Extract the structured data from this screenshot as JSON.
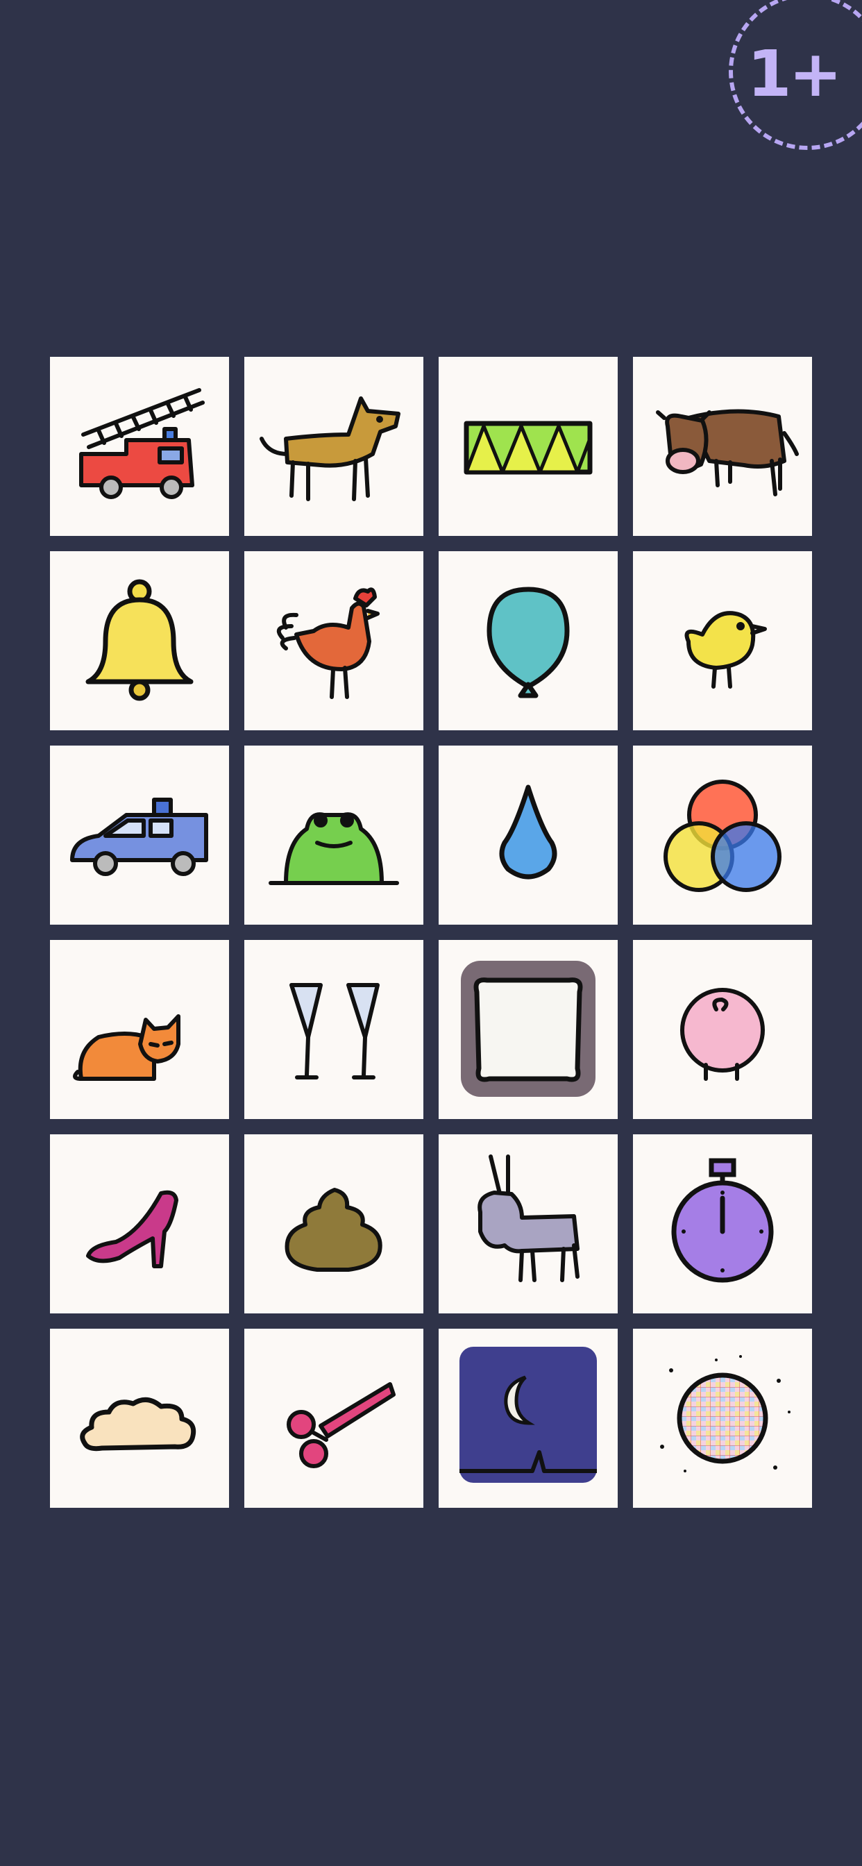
{
  "age_badge": {
    "label": "1+"
  },
  "cards": [
    {
      "name": "fire-truck",
      "icon": "fire-truck-icon"
    },
    {
      "name": "dog",
      "icon": "dog-icon"
    },
    {
      "name": "drum",
      "icon": "drum-icon"
    },
    {
      "name": "cow",
      "icon": "cow-icon"
    },
    {
      "name": "bell",
      "icon": "bell-icon"
    },
    {
      "name": "rooster",
      "icon": "rooster-icon"
    },
    {
      "name": "balloon",
      "icon": "balloon-icon"
    },
    {
      "name": "chick",
      "icon": "chick-icon"
    },
    {
      "name": "police-car",
      "icon": "police-car-icon"
    },
    {
      "name": "frog",
      "icon": "frog-icon"
    },
    {
      "name": "water-drop",
      "icon": "water-drop-icon"
    },
    {
      "name": "color-circles",
      "icon": "color-circles-icon"
    },
    {
      "name": "cat",
      "icon": "cat-icon"
    },
    {
      "name": "champagne-glasses",
      "icon": "champagne-glasses-icon"
    },
    {
      "name": "pillow",
      "icon": "pillow-icon"
    },
    {
      "name": "pig",
      "icon": "pig-icon"
    },
    {
      "name": "high-heel",
      "icon": "high-heel-icon"
    },
    {
      "name": "poop",
      "icon": "poop-icon"
    },
    {
      "name": "donkey",
      "icon": "donkey-icon"
    },
    {
      "name": "stopwatch",
      "icon": "stopwatch-icon"
    },
    {
      "name": "cloud",
      "icon": "cloud-icon"
    },
    {
      "name": "scissors",
      "icon": "scissors-icon"
    },
    {
      "name": "night-moon",
      "icon": "moon-night-icon"
    },
    {
      "name": "disco-ball",
      "icon": "disco-ball-icon"
    }
  ],
  "colors": {
    "background": "#2f3349",
    "tile": "#fcf9f6",
    "badge": "#b7a6f2"
  }
}
